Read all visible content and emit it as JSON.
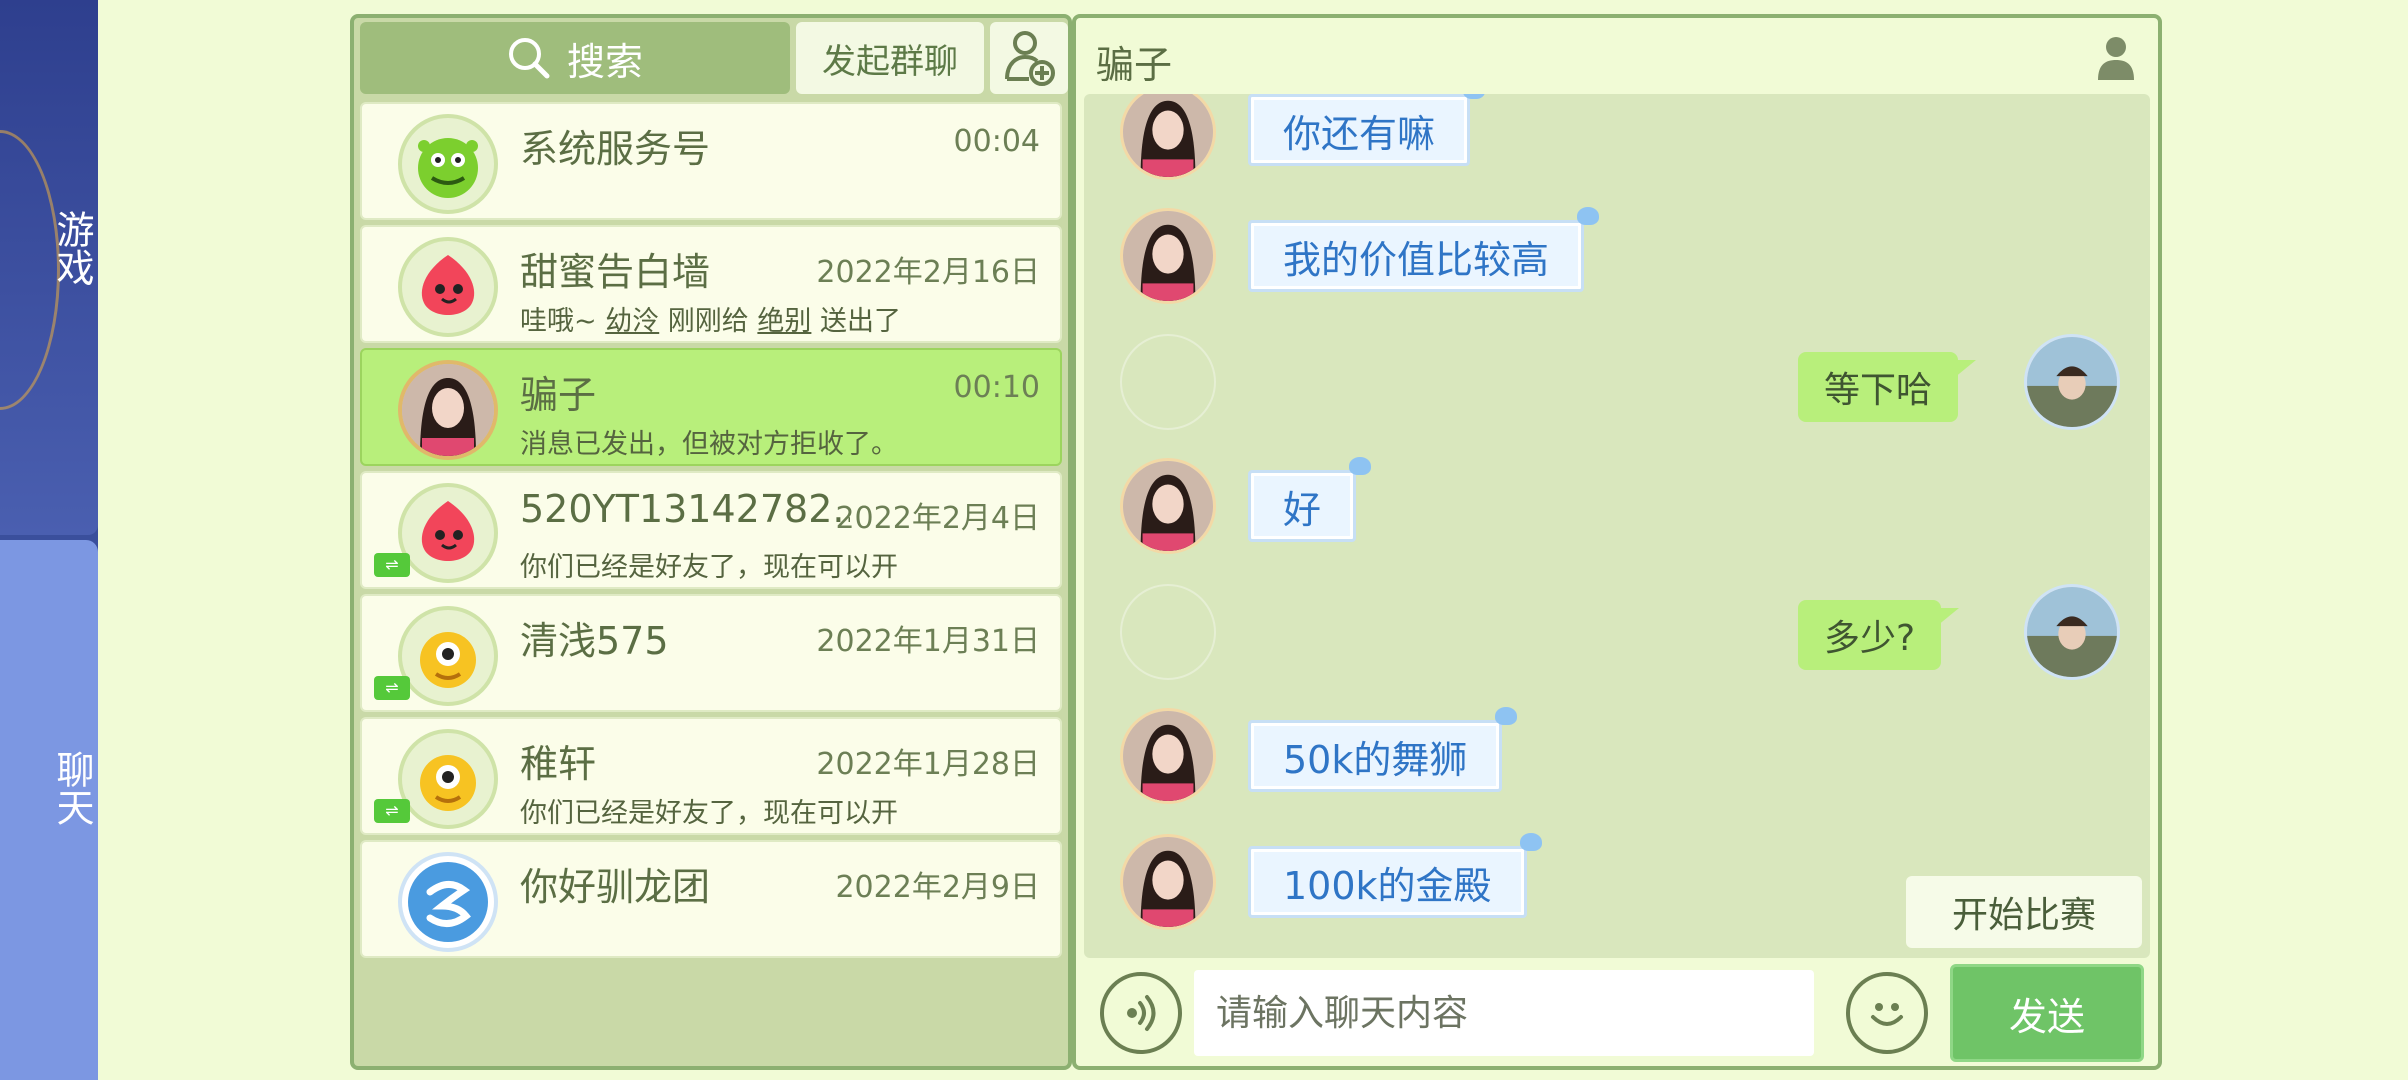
{
  "rail": {
    "game_label": "游戏",
    "chat_label": "聊天"
  },
  "left": {
    "search_label": "搜索",
    "group_chat_label": "发起群聊",
    "conversations": [
      {
        "name": "系统服务号",
        "time": "00:04",
        "preview": ""
      },
      {
        "name": "甜蜜告白墙",
        "time": "2022年2月16日",
        "preview_parts": [
          "哇哦~ ",
          "幼泠",
          " 刚刚给 ",
          "绝别",
          " 送出了"
        ]
      },
      {
        "name": "骗子",
        "time": "00:10",
        "preview": "消息已发出，但被对方拒收了。"
      },
      {
        "name": "520YT13142782...",
        "time": "2022年2月4日",
        "preview": "你们已经是好友了，现在可以开"
      },
      {
        "name": "清浅575",
        "time": "2022年1月31日",
        "preview": ""
      },
      {
        "name": "稚轩",
        "time": "2022年1月28日",
        "preview": "你们已经是好友了，现在可以开"
      },
      {
        "name": "你好驯龙团",
        "time": "2022年2月9日",
        "preview": ""
      }
    ]
  },
  "chat": {
    "title": "骗子",
    "messages": [
      {
        "side": "left",
        "text": "你还有嘛"
      },
      {
        "side": "left",
        "text": "我的价值比较高"
      },
      {
        "side": "right",
        "text": "等下哈"
      },
      {
        "side": "left",
        "text": "好"
      },
      {
        "side": "right",
        "text": "多少?"
      },
      {
        "side": "left",
        "text": "50k的舞狮"
      },
      {
        "side": "left",
        "text": "100k的金殿"
      }
    ],
    "start_match_label": "开始比赛",
    "input_placeholder": "请输入聊天内容",
    "send_label": "发送"
  },
  "icons": {
    "search": "search-icon",
    "add_friend": "add-friend-icon",
    "profile": "profile-icon",
    "voice": "voice-icon",
    "emoji": "emoji-icon"
  },
  "colors": {
    "active_row": "#b8ef7b",
    "send_button": "#6fc467",
    "left_bubble_text": "#2f75c6",
    "rail": "#3a4f9c",
    "rail_chat_tab": "#7c97e2"
  }
}
